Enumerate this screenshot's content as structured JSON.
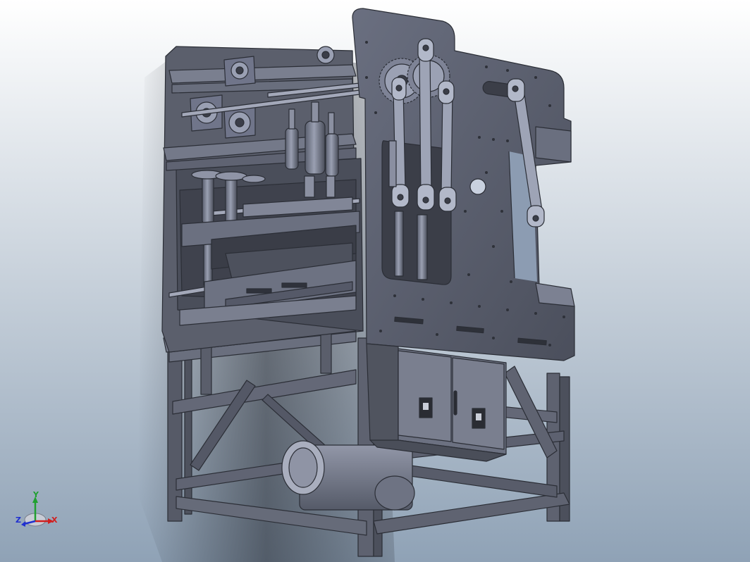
{
  "app": {
    "title": "",
    "colors": {
      "bg_top": "#ffffff",
      "bg_bottom": "#8fa2b6",
      "accent": "#4f5361"
    }
  },
  "viewport": {
    "model_name": "",
    "triad": {
      "x_label": "X",
      "y_label": "Y",
      "z_label": "Z",
      "x_color": "#d02020",
      "y_color": "#20a030",
      "z_color": "#2030d0"
    }
  }
}
